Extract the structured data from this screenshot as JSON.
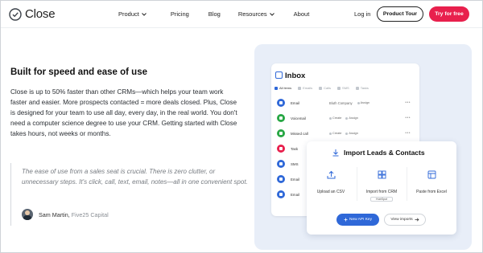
{
  "nav": {
    "logo_text": "Close",
    "links": [
      {
        "label": "Product",
        "dropdown": true
      },
      {
        "label": "Pricing",
        "dropdown": false
      },
      {
        "label": "Blog",
        "dropdown": false
      },
      {
        "label": "Resources",
        "dropdown": true
      },
      {
        "label": "About",
        "dropdown": false
      }
    ],
    "login": "Log in",
    "tour": "Product Tour",
    "try": "Try for free"
  },
  "main": {
    "headline": "Built for speed and ease of use",
    "body": "Close is up to 50% faster than other CRMs—which helps your team work faster and easier. More prospects contacted = more deals closed. Plus, Close is designed for your team to use all day, every day, in the real world. You don't need a computer science degree to use your CRM. Getting started with Close takes hours, not weeks or months.",
    "quote": "The ease of use from a sales seat is crucial. There is zero clutter, or unnecessary steps. It's click, call, text, email, notes—all in one convenient spot.",
    "author": "Sam Martin,",
    "author_company": "Five25 Capital"
  },
  "inbox": {
    "title": "Inbox",
    "filters": [
      "All items",
      "Emails",
      "Calls",
      "SMS",
      "Tasks"
    ],
    "rows": [
      {
        "type": "Email",
        "extra": "Bluth Company",
        "chips": [
          "Assign"
        ],
        "color": "#2f68d8"
      },
      {
        "type": "Voicemail",
        "extra": "",
        "chips": [
          "Create",
          "Assign"
        ],
        "color": "#28a745"
      },
      {
        "type": "Missed call",
        "extra": "",
        "chips": [
          "Create",
          "Assign"
        ],
        "color": "#28a745"
      },
      {
        "type": "Task",
        "extra": "",
        "chips": [],
        "color": "#e8204d"
      },
      {
        "type": "SMS",
        "extra": "",
        "chips": [],
        "color": "#2f68d8"
      },
      {
        "type": "Email",
        "extra": "",
        "chips": [],
        "color": "#2f68d8"
      },
      {
        "type": "Email",
        "extra": "",
        "chips": [],
        "color": "#2f68d8"
      }
    ]
  },
  "import": {
    "title": "Import Leads & Contacts",
    "options": [
      {
        "label": "Upload an CSV",
        "sub": ""
      },
      {
        "label": "Import from CRM",
        "sub": "HubSpot"
      },
      {
        "label": "Paste from Excel",
        "sub": ""
      }
    ],
    "api_button": "New API Key",
    "imports_button": "View imports"
  },
  "colors": {
    "accent": "#e8204d",
    "blue": "#2f68d8",
    "panel_bg": "#e8eef8"
  }
}
